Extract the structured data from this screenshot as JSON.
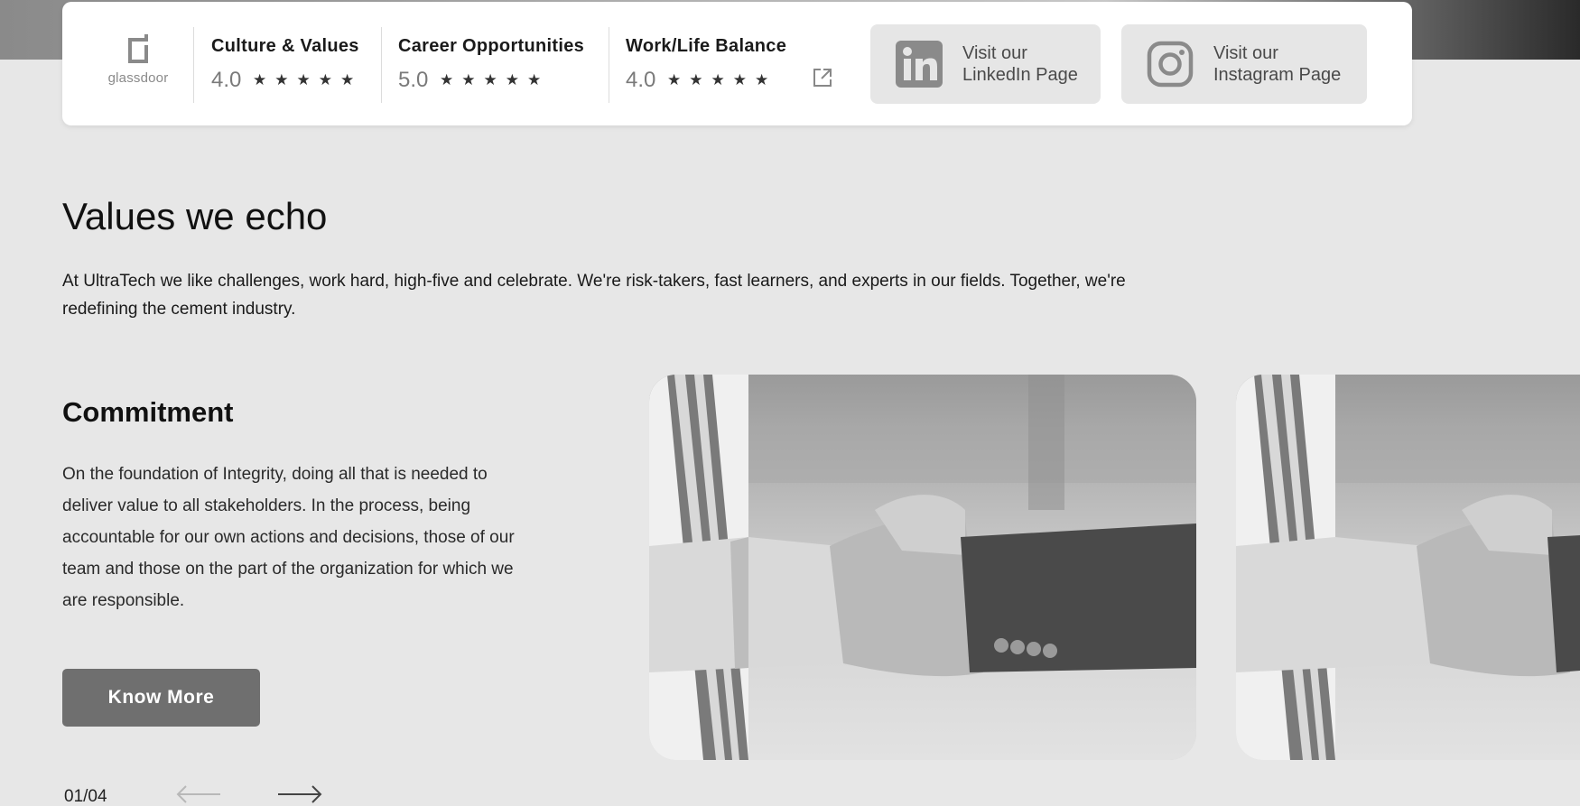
{
  "ratings": {
    "logo_text": "glassdoor",
    "items": [
      {
        "title": "Culture & Values",
        "score": "4.0",
        "stars": "★★★★★"
      },
      {
        "title": "Career Opportunities",
        "score": "5.0",
        "stars": "★★★★★"
      },
      {
        "title": "Work/Life Balance",
        "score": "4.0",
        "stars": "★★★★★"
      }
    ],
    "external_link_icon": "external-link-icon"
  },
  "social": {
    "linkedin": {
      "line1": "Visit our",
      "line2": "LinkedIn Page",
      "icon": "linkedin-icon"
    },
    "instagram": {
      "line1": "Visit our",
      "line2": "Instagram Page",
      "icon": "instagram-icon"
    }
  },
  "values_section": {
    "title": "Values we echo",
    "description": "At UltraTech we like challenges, work hard, high-five and celebrate. We're risk-takers, fast learners, and experts in our fields. Together, we're redefining the cement industry."
  },
  "current_value": {
    "title": "Commitment",
    "description": "On the foundation of Integrity, doing all that is needed to deliver value to all stakeholders. In the process, being accountable for our own actions and decisions, those of our team and those on the part of the organization for which we are responsible.",
    "button_label": "Know More"
  },
  "carousel": {
    "pager": "01/04"
  },
  "colors": {
    "page_background": "#e7e7e7",
    "card_background": "#ffffff",
    "button_background": "#6f6f6f",
    "social_button_background": "#e6e6e6"
  }
}
